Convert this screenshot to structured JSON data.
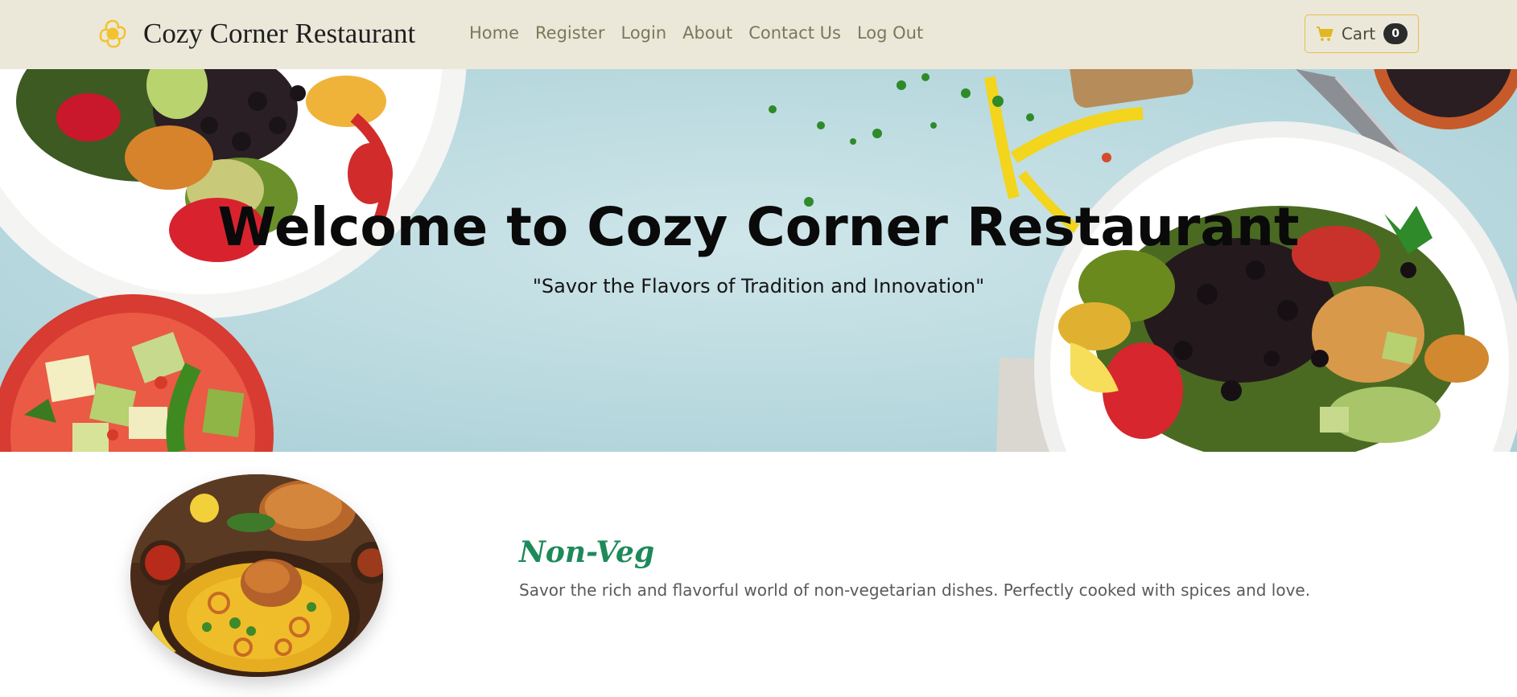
{
  "navbar": {
    "brand": {
      "name": "Cozy Corner Restaurant",
      "logo_icon": "flower-icon",
      "logo_color": "#f2c230"
    },
    "links": [
      {
        "label": "Home"
      },
      {
        "label": "Register"
      },
      {
        "label": "Login"
      },
      {
        "label": "About"
      },
      {
        "label": "Contact Us"
      },
      {
        "label": "Log Out"
      }
    ],
    "cart": {
      "label": "Cart",
      "count": "0",
      "icon": "cart-icon",
      "icon_color": "#e2b721"
    },
    "background_color": "#ebe8da",
    "link_color": "#777a59"
  },
  "hero": {
    "title": "Welcome to Cozy Corner Restaurant",
    "subtitle": "\"Savor the Flavors of Tradition and Innovation\"",
    "background_color": "#c2dfe3"
  },
  "category": {
    "title": "Non-Veg",
    "description": "Savor the rich and flavorful world of non-vegetarian dishes. Perfectly cooked with spices and love.",
    "title_color": "#1e8a5a"
  }
}
